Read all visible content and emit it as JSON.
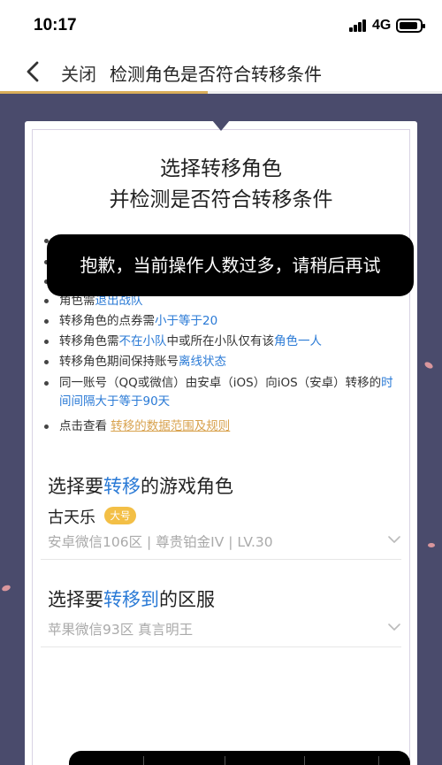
{
  "status_bar": {
    "time": "10:17",
    "network": "4G"
  },
  "nav": {
    "close_label": "关闭",
    "title": "检测角色是否符合转移条件",
    "progress_fraction": 0.47
  },
  "card": {
    "title_line1": "选择转移角色",
    "title_line2": "并检测是否符合转移条件",
    "requirements": {
      "r4": {
        "prefix": "角色需",
        "highlight": "退出战队"
      },
      "r5": {
        "prefix": "转移角色的点券需",
        "highlight": "小于等于20"
      },
      "r6": {
        "prefix": "转移角色需",
        "highlight1": "不在小队",
        "middle": "中或所在小队仅有该",
        "highlight2": "角色一人"
      },
      "r7": {
        "prefix": "转移角色期间保持账号",
        "highlight": "离线状态"
      },
      "r8": {
        "prefix": "同一账号（QQ或微信）由安卓（iOS）向iOS（安卓）转移的",
        "highlight": "时间间隔大于等于90天"
      },
      "r9": {
        "prefix": "点击查看",
        "link": "转移的数据范围及规则"
      }
    }
  },
  "toast": {
    "message": "抱歉，当前操作人数过多，请稍后再试"
  },
  "section_role": {
    "title_prefix": "选择要",
    "title_highlight": "转移",
    "title_suffix": "的游戏角色",
    "character_name": "古天乐",
    "badge": "大号",
    "details": "安卓微信106区 | 尊贵铂金IV | LV.30"
  },
  "section_server": {
    "title_prefix": "选择要",
    "title_highlight": "转移到",
    "title_suffix": "的区服",
    "value": "苹果微信93区 真言明王"
  },
  "colors": {
    "accent_blue": "#2a7ad6",
    "gold": "#d9ae5a",
    "background": "#4a4b6c"
  }
}
